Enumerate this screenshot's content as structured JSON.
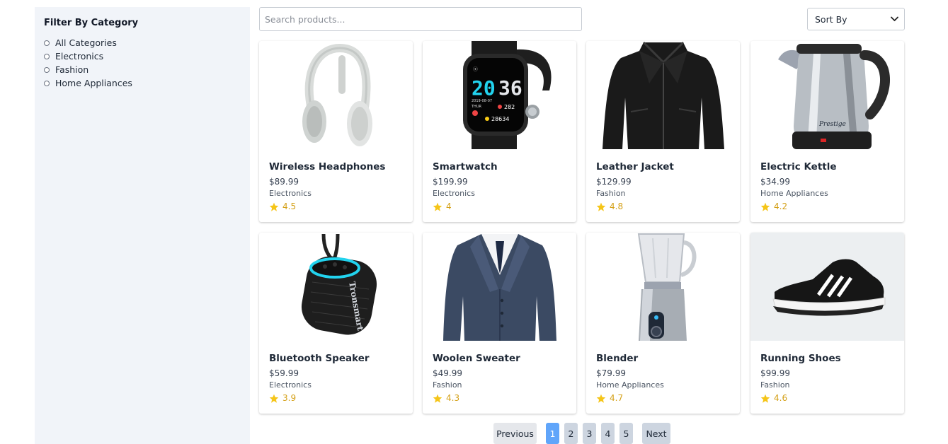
{
  "sidebar": {
    "title": "Filter By Category",
    "options": [
      "All Categories",
      "Electronics",
      "Fashion",
      "Home Appliances"
    ]
  },
  "search": {
    "placeholder": "Search products..."
  },
  "sort": {
    "label": "Sort By"
  },
  "products": [
    {
      "name": "Wireless Headphones",
      "price": "$89.99",
      "category": "Electronics",
      "rating": "4.5",
      "image": "headphones-image"
    },
    {
      "name": "Smartwatch",
      "price": "$199.99",
      "category": "Electronics",
      "rating": "4",
      "image": "smartwatch-image"
    },
    {
      "name": "Leather Jacket",
      "price": "$129.99",
      "category": "Fashion",
      "rating": "4.8",
      "image": "jacket-image"
    },
    {
      "name": "Electric Kettle",
      "price": "$34.99",
      "category": "Home Appliances",
      "rating": "4.2",
      "image": "kettle-image"
    },
    {
      "name": "Bluetooth Speaker",
      "price": "$59.99",
      "category": "Electronics",
      "rating": "3.9",
      "image": "speaker-image"
    },
    {
      "name": "Woolen Sweater",
      "price": "$49.99",
      "category": "Fashion",
      "rating": "4.3",
      "image": "sweater-image"
    },
    {
      "name": "Blender",
      "price": "$79.99",
      "category": "Home Appliances",
      "rating": "4.7",
      "image": "blender-image"
    },
    {
      "name": "Running Shoes",
      "price": "$99.99",
      "category": "Fashion",
      "rating": "4.6",
      "image": "shoes-image"
    }
  ],
  "smartwatch_screen": {
    "time_hour": "20",
    "time_min": "36",
    "steps": "28634",
    "hr": "282",
    "date": "2019-08-07",
    "day": "THUR"
  },
  "product_brand_marks": {
    "kettle": "Prestige",
    "speaker": "Tronsmart"
  },
  "pagination": {
    "previous": "Previous",
    "next": "Next",
    "pages": [
      "1",
      "2",
      "3",
      "4",
      "5"
    ],
    "current": "1"
  },
  "colors": {
    "star": "#f5c518",
    "rating_text": "#d4a017",
    "active_page": "#60a5fa",
    "sidebar_bg": "#f1f4f9"
  }
}
